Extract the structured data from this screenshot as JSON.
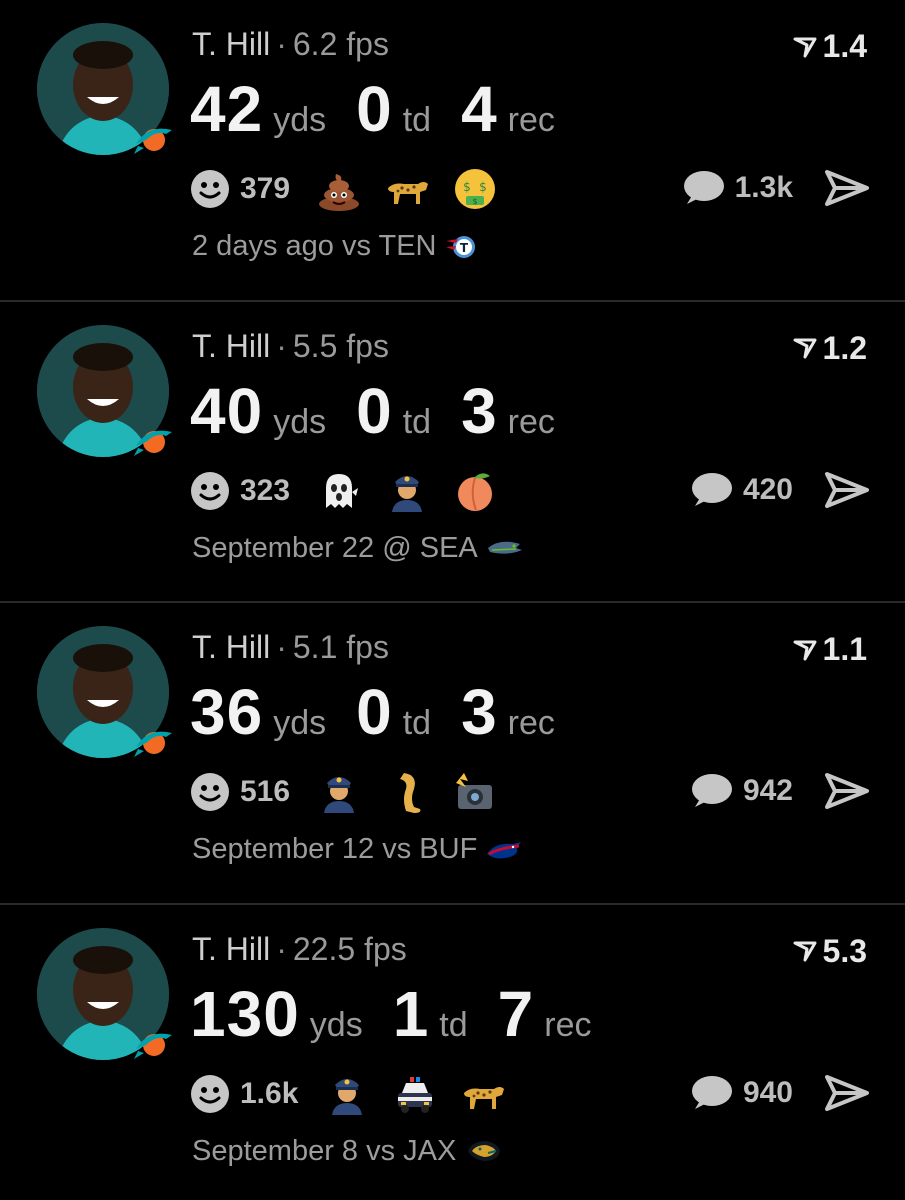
{
  "colors": {
    "background": "#000000",
    "divider": "#2a2a2a",
    "muted": "#9a9a9a"
  },
  "feed": [
    {
      "player": "T. Hill",
      "fps": "6.2 fps",
      "score": "1.4",
      "yds": "42",
      "yds_unit": "yds",
      "td": "0",
      "td_unit": "td",
      "rec": "4",
      "rec_unit": "rec",
      "reaction_count": "379",
      "emojis": [
        "poop-emoji",
        "leopard-emoji",
        "money-mouth-emoji"
      ],
      "comments": "1.3k",
      "when": "2 days ago vs TEN",
      "opponent_logo": "titans-logo"
    },
    {
      "player": "T. Hill",
      "fps": "5.5 fps",
      "score": "1.2",
      "yds": "40",
      "yds_unit": "yds",
      "td": "0",
      "td_unit": "td",
      "rec": "3",
      "rec_unit": "rec",
      "reaction_count": "323",
      "emojis": [
        "ghost-emoji",
        "police-officer-emoji",
        "peach-emoji"
      ],
      "comments": "420",
      "when": "September 22 @ SEA",
      "opponent_logo": "seahawks-logo"
    },
    {
      "player": "T. Hill",
      "fps": "5.1 fps",
      "score": "1.1",
      "yds": "36",
      "yds_unit": "yds",
      "td": "0",
      "td_unit": "td",
      "rec": "3",
      "rec_unit": "rec",
      "reaction_count": "516",
      "emojis": [
        "police-officer-emoji",
        "leg-emoji",
        "camera-flash-emoji"
      ],
      "comments": "942",
      "when": "September 12 vs BUF",
      "opponent_logo": "bills-logo"
    },
    {
      "player": "T. Hill",
      "fps": "22.5 fps",
      "score": "5.3",
      "yds": "130",
      "yds_unit": "yds",
      "td": "1",
      "td_unit": "td",
      "rec": "7",
      "rec_unit": "rec",
      "reaction_count": "1.6k",
      "emojis": [
        "police-officer-emoji",
        "police-car-emoji",
        "leopard-emoji"
      ],
      "comments": "940",
      "when": "September 8 vs JAX",
      "opponent_logo": "jaguars-logo"
    }
  ]
}
